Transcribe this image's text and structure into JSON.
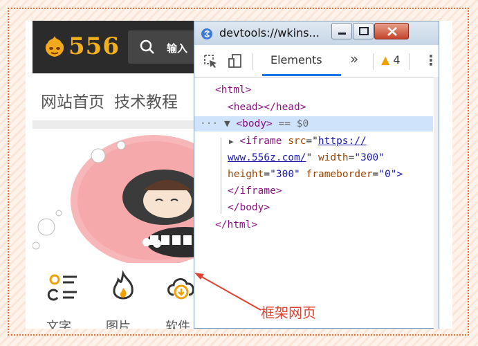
{
  "site": {
    "logo_text": "556",
    "search_placeholder": "输入",
    "nav": [
      "网站首页",
      "技术教程"
    ],
    "category_labels": [
      "文字",
      "图片",
      "软件"
    ]
  },
  "devtools": {
    "title": "devtools://wkins...",
    "tab_elements": "Elements",
    "more_tabs": "»",
    "warning_count": "4",
    "menu": "⋮",
    "dom": {
      "html_open": "<html>",
      "head": "<head></head>",
      "body_open": "<body>",
      "body_dots": "···",
      "body_marker": "▼",
      "body_selected": "== $0",
      "iframe_arrow": "▶",
      "iframe_open": "<iframe",
      "iframe_src_attr": "src",
      "iframe_src_pre": "https://",
      "iframe_src_line2": "www.556z.com/",
      "width_attr": "width",
      "width_val": "\"300\"",
      "height_attr": "height",
      "height_val": "\"300\"",
      "frameborder_attr": "frameborder",
      "frameborder_val": "\"0\">",
      "iframe_close": "</iframe>",
      "body_close": "</body>",
      "html_close": "</html>"
    }
  },
  "annotation": "框架网页",
  "colors": {
    "accent_red": "#e0402f",
    "logo_gold": "#f2b11c",
    "tab_underline": "#1a73e8"
  },
  "icons": [
    "logo-face-icon",
    "search-icon",
    "inspect-icon",
    "device-toggle-icon",
    "warning-icon",
    "minimize-icon",
    "maximize-icon",
    "close-icon",
    "list-icon",
    "fire-icon",
    "cloud-download-icon"
  ]
}
